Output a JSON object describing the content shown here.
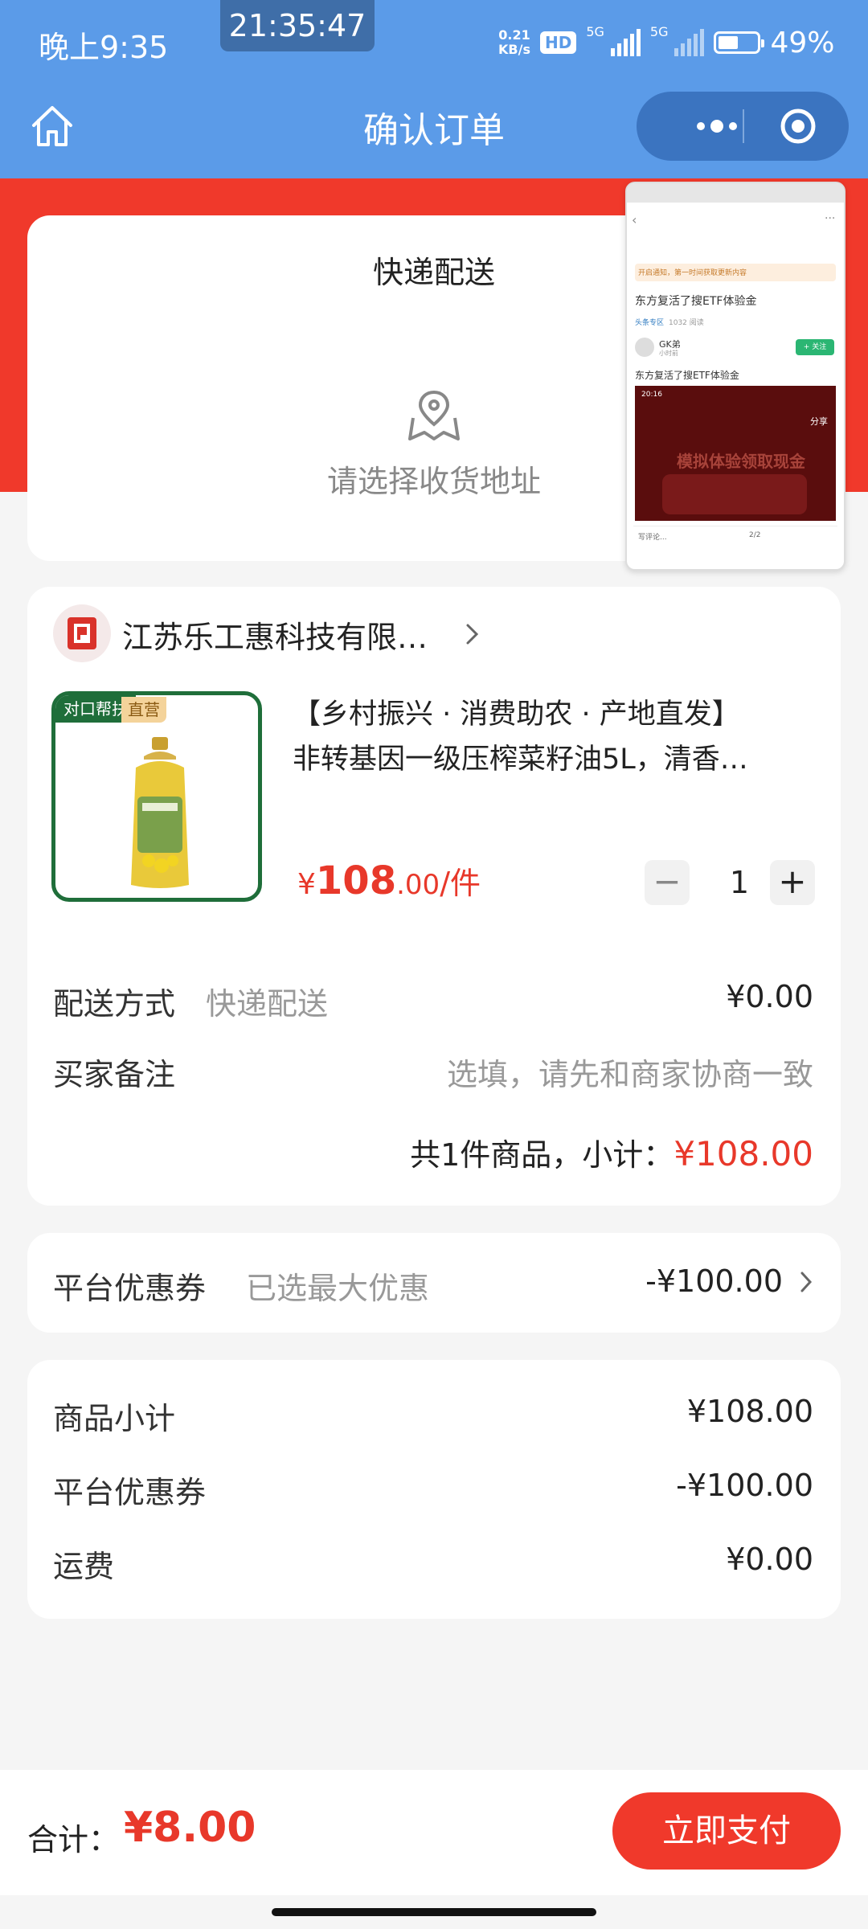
{
  "status_bar": {
    "time": "晚上9:35",
    "clock_pill": "21:35:47",
    "net_speed_value": "0.21",
    "net_speed_unit": "KB/s",
    "hd": "HD",
    "sig1": "5G",
    "sig2": "5G",
    "battery": "49%"
  },
  "nav": {
    "title": "确认订单"
  },
  "address": {
    "delivery_title": "快递配送",
    "placeholder": "请选择收货地址"
  },
  "pip": {
    "banner": "开启通知，第一时间获取更新内容",
    "title": "东方复活了搜ETF体验金",
    "section": "头条专区",
    "views": "1032 阅读",
    "user": "GK弟",
    "user_sub": "小时前",
    "follow": "+ 关注",
    "body": "东方复活了搜ETF体验金",
    "shot_time": "20:16",
    "shot_share": "分享",
    "shot_headline": "模拟体验领取现金",
    "comment": "写评论...",
    "page": "2/2"
  },
  "shop": {
    "name": "江苏乐工惠科技有限…",
    "tag_green": "对口帮扶",
    "tag_gold": "直营",
    "product_title_line1": "【乡村振兴 · 消费助农 · 产地直发】",
    "product_title_line2": "非转基因一级压榨菜籽油5L，清香…",
    "price_currency": "¥",
    "price_int": "108",
    "price_dec": ".00",
    "price_unit": "/件",
    "qty": "1",
    "minus": "−",
    "plus": "+",
    "shipping_label": "配送方式",
    "shipping_method": "快递配送",
    "shipping_fee": "¥0.00",
    "note_label": "买家备注",
    "note_placeholder": "选填，请先和商家协商一致",
    "subtotal_prefix": "共1件商品，小计：",
    "subtotal_amount": "¥108.00"
  },
  "coupon": {
    "label": "平台优惠券",
    "hint": "已选最大优惠",
    "value": "-¥100.00"
  },
  "summary": {
    "rows": [
      {
        "label": "商品小计",
        "value": "¥108.00"
      },
      {
        "label": "平台优惠券",
        "value": "-¥100.00"
      },
      {
        "label": "运费",
        "value": "¥0.00"
      }
    ]
  },
  "footer": {
    "total_label": "合计：",
    "total_amount": "¥8.00",
    "pay_button": "立即支付"
  },
  "colors": {
    "nav_blue": "#5b9be8",
    "accent_red": "#f0392b",
    "price_red": "#e8382a",
    "tag_green": "#1f6e3a"
  }
}
